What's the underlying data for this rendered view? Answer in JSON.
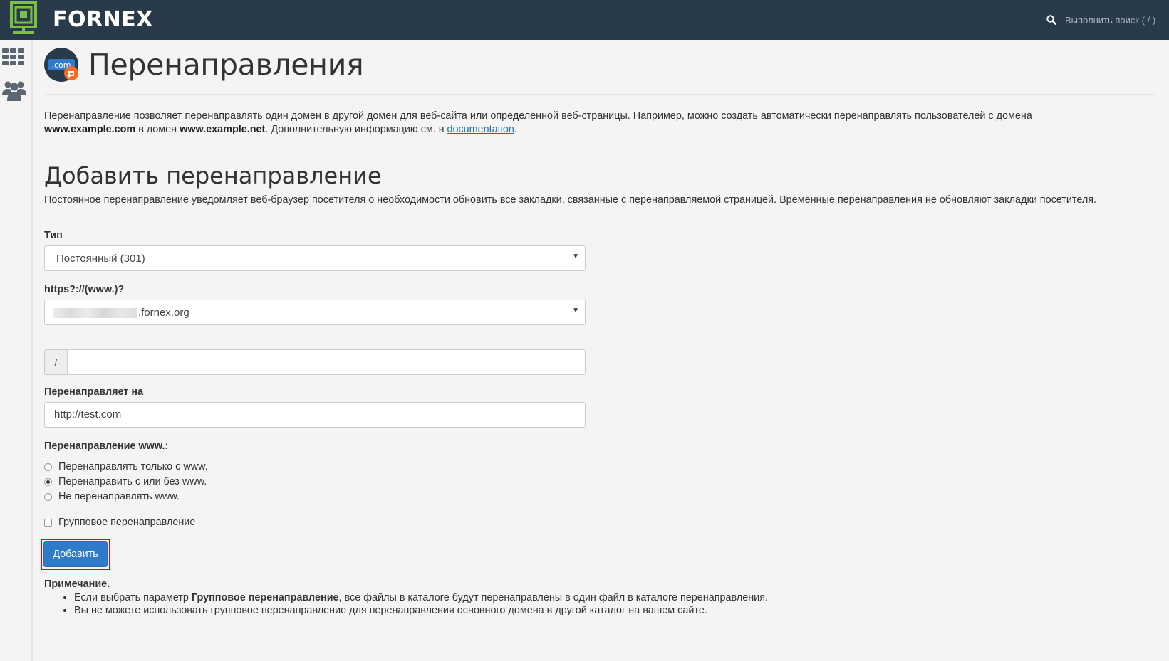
{
  "brand": {
    "name": "FORNEX",
    "logo_color": "#7ac143"
  },
  "search": {
    "placeholder": "Выполнить поиск ( / )"
  },
  "page": {
    "title": "Перенаправления",
    "icon_text": ".com",
    "intro_part1": "Перенаправление позволяет перенаправлять один домен в другой домен для веб-сайта или определенной веб-страницы. Например, можно создать автоматически перенаправлять пользователей с домена",
    "intro_domain1": "www.example.com",
    "intro_part2": " в домен ",
    "intro_domain2": "www.example.net",
    "intro_part3": ". Дополнительную информацию см. в ",
    "intro_link": "documentation",
    "intro_end": "."
  },
  "form": {
    "heading": "Добавить перенаправление",
    "description": "Постоянное перенаправление уведомляет веб-браузер посетителя о необходимости обновить все закладки, связанные с перенаправляемой страницей. Временные перенаправления не обновляют закладки посетителя.",
    "type_label": "Тип",
    "type_value": "Постоянный (301)",
    "domain_label": "https?://(www.)?",
    "domain_suffix": ".fornex.org",
    "path_prefix": "/",
    "path_value": "",
    "redirect_to_label": "Перенаправляет на",
    "redirect_to_value": "http://test.com",
    "www_label": "Перенаправление www.:",
    "www_options": [
      {
        "label": "Перенаправлять только с www.",
        "selected": false
      },
      {
        "label": "Перенаправить с или без www.",
        "selected": true
      },
      {
        "label": "Не перенаправлять www.",
        "selected": false
      }
    ],
    "wildcard_label": "Групповое перенаправление",
    "wildcard_checked": false,
    "submit_label": "Добавить"
  },
  "notes": {
    "title": "Примечание.",
    "item1_pre": "Если выбрать параметр ",
    "item1_bold": "Групповое перенаправление",
    "item1_post": ", все файлы в каталоге будут перенаправлены в один файл в каталоге перенаправления.",
    "item2": "Вы не можете использовать групповое перенаправление для перенаправления основного домена в другой каталог на вашем сайте."
  }
}
